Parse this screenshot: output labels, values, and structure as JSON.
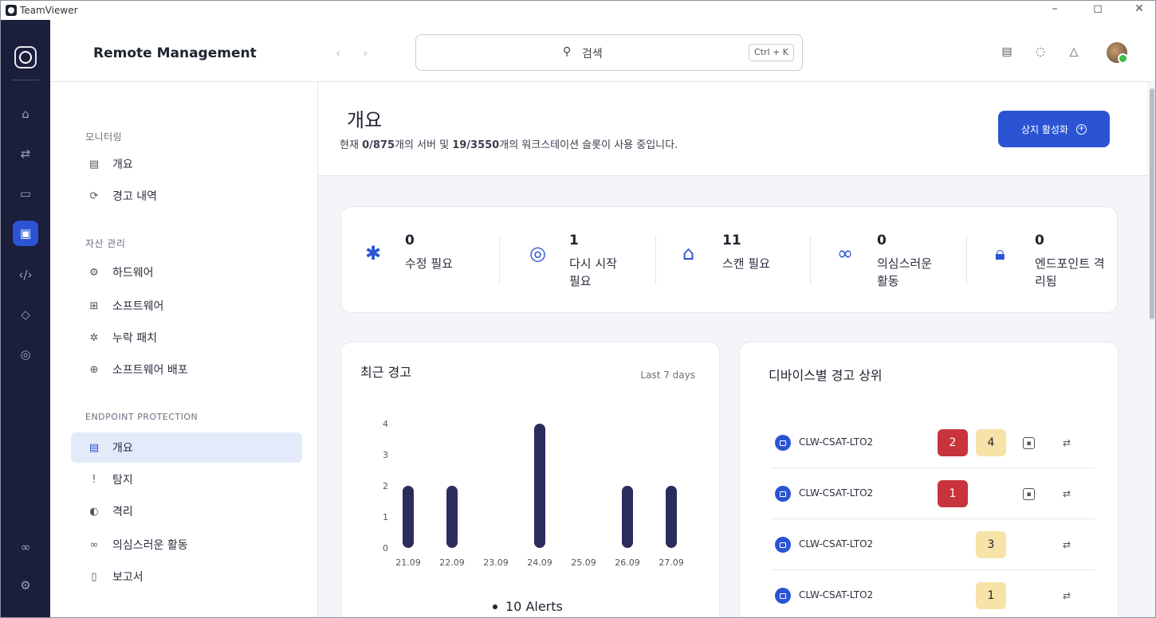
{
  "window": {
    "app_name": "TeamViewer",
    "controls": [
      "–",
      "◻",
      "✕"
    ]
  },
  "rail": {
    "icons": [
      "home-icon",
      "transfer-icon",
      "devices-icon",
      "remote-management-icon",
      "code-icon",
      "tag-icon",
      "target-icon",
      "integrations-icon",
      "settings-icon"
    ],
    "active": "remote-management-icon"
  },
  "header": {
    "title": "Remote Management",
    "search": {
      "placeholder": "검색",
      "shortcut": "Ctrl + K"
    }
  },
  "sidebar": {
    "sections": [
      {
        "heading": "모니터링",
        "items": [
          {
            "label": "개요",
            "icon": "dashboard-icon"
          },
          {
            "label": "경고 내역",
            "icon": "alert-history-icon"
          }
        ]
      },
      {
        "heading": "자산 관리",
        "items": [
          {
            "label": "하드웨어",
            "icon": "hardware-icon"
          },
          {
            "label": "소프트웨어",
            "icon": "software-icon"
          },
          {
            "label": "누락 패치",
            "icon": "patch-icon"
          },
          {
            "label": "소프트웨어 배포",
            "icon": "deploy-icon"
          }
        ]
      },
      {
        "heading": "ENDPOINT PROTECTION",
        "items": [
          {
            "label": "개요",
            "icon": "dashboard-icon",
            "active": true
          },
          {
            "label": "탐지",
            "icon": "detection-icon"
          },
          {
            "label": "격리",
            "icon": "quarantine-icon"
          },
          {
            "label": "의심스러운 활동",
            "icon": "suspicious-icon"
          },
          {
            "label": "보고서",
            "icon": "report-icon"
          }
        ]
      }
    ]
  },
  "page": {
    "title": "개요",
    "subtitle_pre": "현재 ",
    "servers": "0/875",
    "subtitle_mid": "개의 서버 및 ",
    "workstations": "19/3550",
    "subtitle_post": "개의 워크스테이션 슬롯이 사용 중입니다.",
    "activate_button": "상지 활성화"
  },
  "stats": [
    {
      "value": "0",
      "label": "수정 필요",
      "icon": "bug-icon"
    },
    {
      "value": "1",
      "label": "다시 시작 필요",
      "icon": "restart-icon"
    },
    {
      "value": "11",
      "label": "스캔 필요",
      "icon": "scan-icon"
    },
    {
      "value": "0",
      "label": "의심스러운 활동",
      "icon": "spy-icon"
    },
    {
      "value": "0",
      "label": "엔드포인트 격리됨",
      "icon": "lock-icon"
    }
  ],
  "recent_alerts": {
    "title": "최근 경고",
    "range": "Last 7 days",
    "legend": "10 Alerts"
  },
  "chart_data": {
    "type": "bar",
    "categories": [
      "21.09",
      "22.09",
      "23.09",
      "24.09",
      "25.09",
      "26.09",
      "27.09"
    ],
    "values": [
      2,
      2,
      0,
      4,
      0,
      2,
      2
    ],
    "series_color": "#2a2d5c",
    "ylim": [
      0,
      4
    ],
    "yticks": [
      "0",
      "1",
      "2",
      "3",
      "4"
    ],
    "grid": false,
    "legend": "bottom"
  },
  "top_devices": {
    "title": "디바이스별 경고 상위",
    "rows": [
      {
        "name": "CLW-CSAT-LTO2",
        "red": "2",
        "yellow": "4",
        "remote": true
      },
      {
        "name": "CLW-CSAT-LTO2",
        "red": "1",
        "yellow": "",
        "remote": true
      },
      {
        "name": "CLW-CSAT-LTO2",
        "red": "",
        "yellow": "3",
        "remote": false
      },
      {
        "name": "CLW-CSAT-LTO2",
        "red": "",
        "yellow": "1",
        "remote": false
      }
    ]
  },
  "colors": {
    "accent": "#2b54d4",
    "rail": "#1b1f3b",
    "badge_red": "#c8343c",
    "badge_yellow": "#f7e2a8"
  }
}
